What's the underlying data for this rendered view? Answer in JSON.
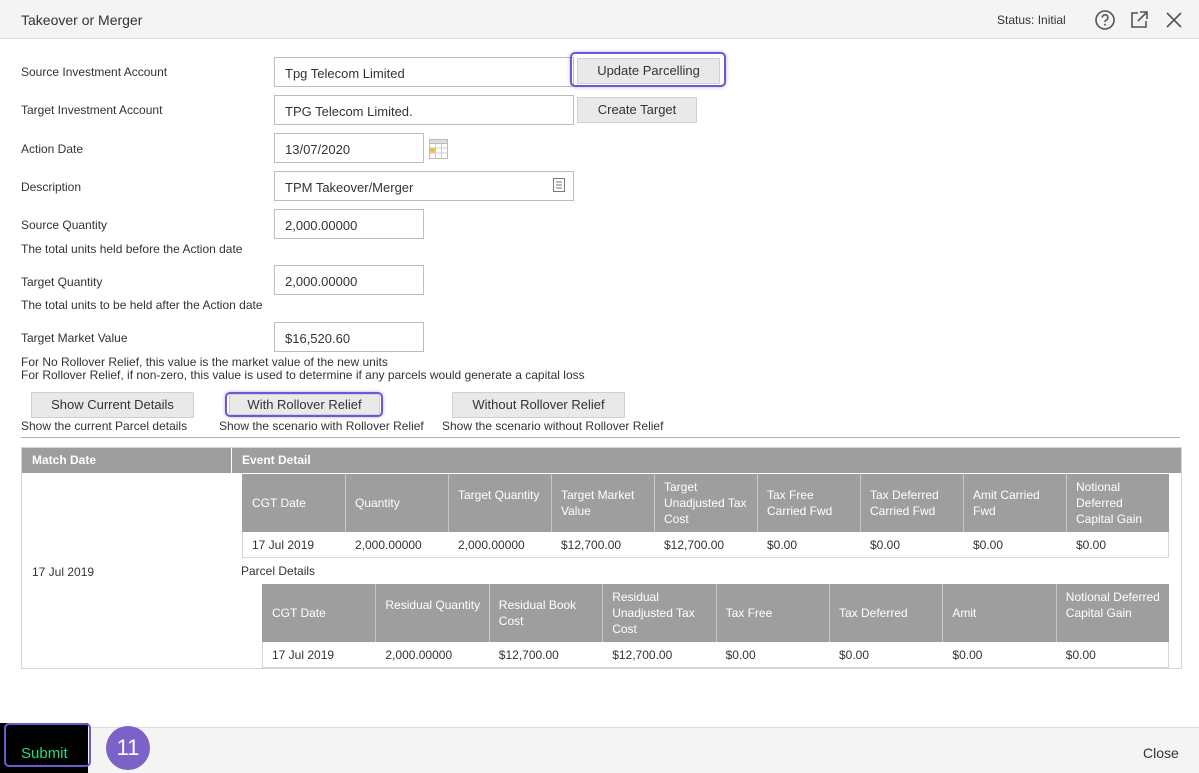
{
  "dialog": {
    "title": "Takeover or Merger",
    "status": "Status: Initial",
    "icons": [
      "help-circle-icon",
      "external-link-icon",
      "close-icon"
    ]
  },
  "form": {
    "source_account_label": "Source Investment Account",
    "source_account_value": "Tpg Telecom Limited",
    "update_parcelling_btn": "Update Parcelling",
    "target_account_label": "Target Investment Account",
    "target_account_value": "TPG Telecom Limited.",
    "create_target_btn": "Create Target",
    "action_date_label": "Action Date",
    "action_date_value": "13/07/2020",
    "description_label": "Description",
    "description_value": "TPM Takeover/Merger",
    "source_qty_label": "Source Quantity",
    "source_qty_value": "2,000.00000",
    "source_qty_hint": "The total units held before the Action date",
    "target_qty_label": "Target Quantity",
    "target_qty_value": "2,000.00000",
    "target_qty_hint": "The total units to be held after the Action date",
    "target_mv_label": "Target Market Value",
    "target_mv_value": "$16,520.60",
    "target_mv_hint1": "For No Rollover Relief, this value is the market value of the new units",
    "target_mv_hint2": "For Rollover Relief, if non-zero, this value is used to determine if any parcels would generate a capital loss"
  },
  "scenarios": {
    "current_btn": "Show Current Details",
    "current_hint": "Show the current Parcel details",
    "with_btn": "With Rollover Relief",
    "with_hint": "Show the scenario with Rollover Relief",
    "without_btn": "Without Rollover Relief",
    "without_hint": "Show the scenario without Rollover Relief"
  },
  "results": {
    "col_match_date": "Match Date",
    "col_event_detail": "Event Detail",
    "match_date": "17 Jul 2019",
    "event_headers": [
      "CGT Date",
      "Quantity",
      "Target Quantity",
      "Target Market Value",
      "Target Unadjusted Tax Cost",
      "Tax Free Carried Fwd",
      "Tax Deferred Carried Fwd",
      "Amit Carried Fwd",
      "Notional Deferred Capital Gain"
    ],
    "event_row": [
      "17 Jul 2019",
      "2,000.00000",
      "2,000.00000",
      "$12,700.00",
      "$12,700.00",
      "$0.00",
      "$0.00",
      "$0.00",
      "$0.00"
    ],
    "parcel_label": "Parcel Details",
    "parcel_headers": [
      "CGT Date",
      "Residual Quantity",
      "Residual Book Cost",
      "Residual Unadjusted Tax Cost",
      "Tax Free",
      "Tax Deferred",
      "Amit",
      "Notional Deferred Capital Gain"
    ],
    "parcel_row": [
      "17 Jul 2019",
      "2,000.00000",
      "$12,700.00",
      "$12,700.00",
      "$0.00",
      "$0.00",
      "$0.00",
      "$0.00"
    ]
  },
  "footer": {
    "submit": "Submit",
    "badge": "11",
    "close": "Close"
  },
  "colors": {
    "highlight": "#6a5acd",
    "table_header": "#9e9e9e",
    "submit_text": "#2fd67a",
    "badge": "#7a62c9"
  }
}
